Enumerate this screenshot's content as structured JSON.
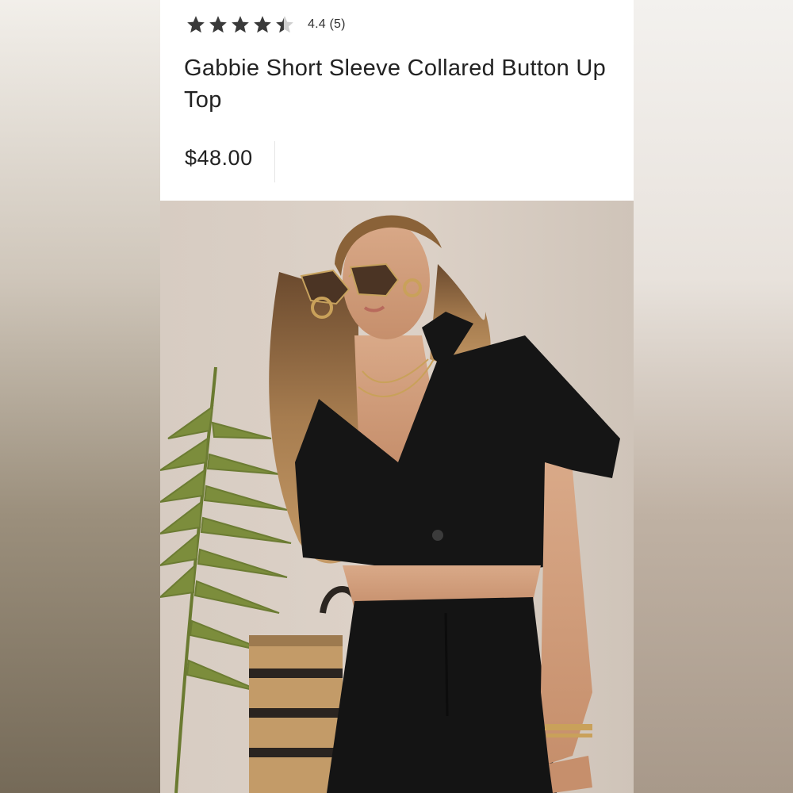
{
  "product": {
    "rating_value": 4.4,
    "rating_text": "4.4 (5)",
    "title": "Gabbie Short Sleeve Collared Button Up Top",
    "price": "$48.00"
  },
  "photo": {
    "subject": "model-wearing-black-crop-top"
  },
  "colors": {
    "star_filled": "#3a3a3a",
    "star_empty": "#cfcfcf",
    "text": "#222222",
    "garment": "#151515"
  }
}
